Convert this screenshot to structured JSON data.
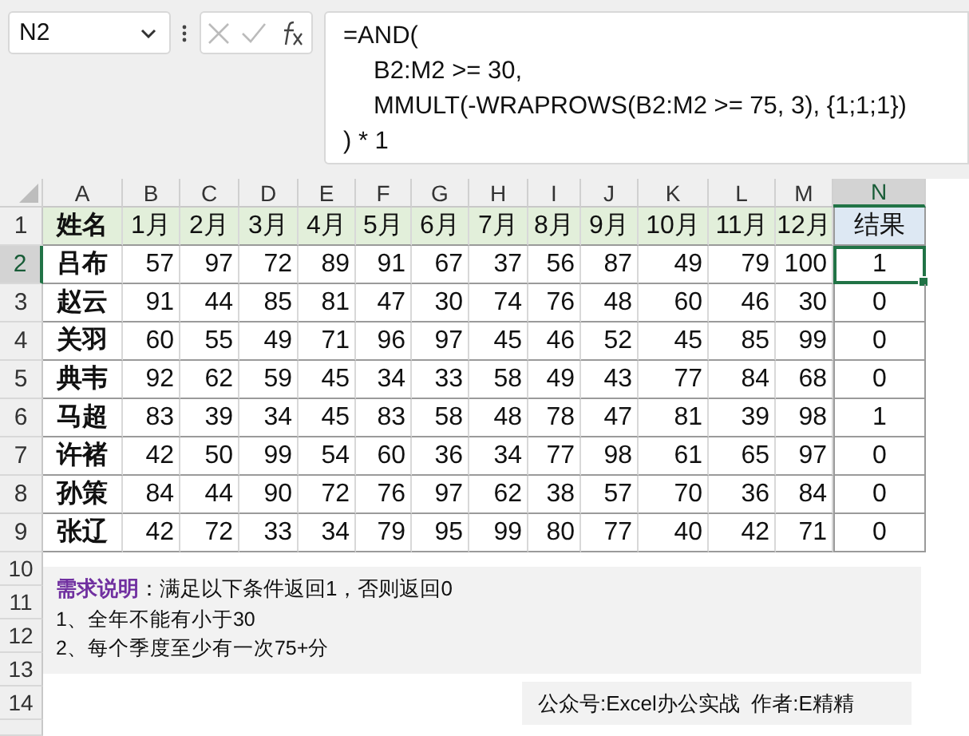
{
  "name_box": "N2",
  "formula_lines": [
    "=AND(",
    "B2:M2 >= 30,",
    "MMULT(-WRAPROWS(B2:M2 >= 75, 3), {1;1;1})",
    ") * 1"
  ],
  "column_headers": [
    {
      "label": "A",
      "selected": false
    },
    {
      "label": "B",
      "selected": false
    },
    {
      "label": "C",
      "selected": false
    },
    {
      "label": "D",
      "selected": false
    },
    {
      "label": "E",
      "selected": false
    },
    {
      "label": "F",
      "selected": false
    },
    {
      "label": "G",
      "selected": false
    },
    {
      "label": "H",
      "selected": false
    },
    {
      "label": "I",
      "selected": false
    },
    {
      "label": "J",
      "selected": false
    },
    {
      "label": "K",
      "selected": false
    },
    {
      "label": "L",
      "selected": false
    },
    {
      "label": "M",
      "selected": false
    },
    {
      "label": "N",
      "selected": true
    }
  ],
  "header_row": {
    "number": "1",
    "name": "姓名",
    "months": [
      "1月",
      "2月",
      "3月",
      "4月",
      "5月",
      "6月",
      "7月",
      "8月",
      "9月",
      "10月",
      "11月",
      "12月"
    ],
    "result": "结果"
  },
  "rows": [
    {
      "number": "2",
      "name": "吕布",
      "values": [
        "57",
        "97",
        "72",
        "89",
        "91",
        "67",
        "37",
        "56",
        "87",
        "49",
        "79",
        "100"
      ],
      "result": "1",
      "selected": true
    },
    {
      "number": "3",
      "name": "赵云",
      "values": [
        "91",
        "44",
        "85",
        "81",
        "47",
        "30",
        "74",
        "76",
        "48",
        "60",
        "46",
        "30"
      ],
      "result": "0",
      "selected": false
    },
    {
      "number": "4",
      "name": "关羽",
      "values": [
        "60",
        "55",
        "49",
        "71",
        "96",
        "97",
        "45",
        "46",
        "52",
        "45",
        "85",
        "99"
      ],
      "result": "0",
      "selected": false
    },
    {
      "number": "5",
      "name": "典韦",
      "values": [
        "92",
        "62",
        "59",
        "45",
        "34",
        "33",
        "58",
        "49",
        "43",
        "77",
        "84",
        "68"
      ],
      "result": "0",
      "selected": false
    },
    {
      "number": "6",
      "name": "马超",
      "values": [
        "83",
        "39",
        "34",
        "45",
        "83",
        "58",
        "48",
        "78",
        "47",
        "81",
        "39",
        "98"
      ],
      "result": "1",
      "selected": false
    },
    {
      "number": "7",
      "name": "许褚",
      "values": [
        "42",
        "50",
        "99",
        "54",
        "60",
        "36",
        "34",
        "77",
        "98",
        "61",
        "65",
        "97"
      ],
      "result": "0",
      "selected": false
    },
    {
      "number": "8",
      "name": "孙策",
      "values": [
        "84",
        "44",
        "90",
        "72",
        "76",
        "97",
        "62",
        "38",
        "57",
        "70",
        "36",
        "84"
      ],
      "result": "0",
      "selected": false
    },
    {
      "number": "9",
      "name": "张辽",
      "values": [
        "42",
        "72",
        "33",
        "34",
        "79",
        "95",
        "99",
        "80",
        "77",
        "40",
        "42",
        "71"
      ],
      "result": "0",
      "selected": false
    }
  ],
  "empty_row_numbers": [
    "10",
    "11",
    "12",
    "13",
    "14"
  ],
  "note": {
    "label": "需求说明",
    "intro": "：满足以下条件返回1，否则返回0",
    "lines": [
      "1、全年不能有小于30",
      "2、每个季度至少有一次75+分"
    ]
  },
  "credit": "公众号:Excel办公实战  作者:E精精"
}
